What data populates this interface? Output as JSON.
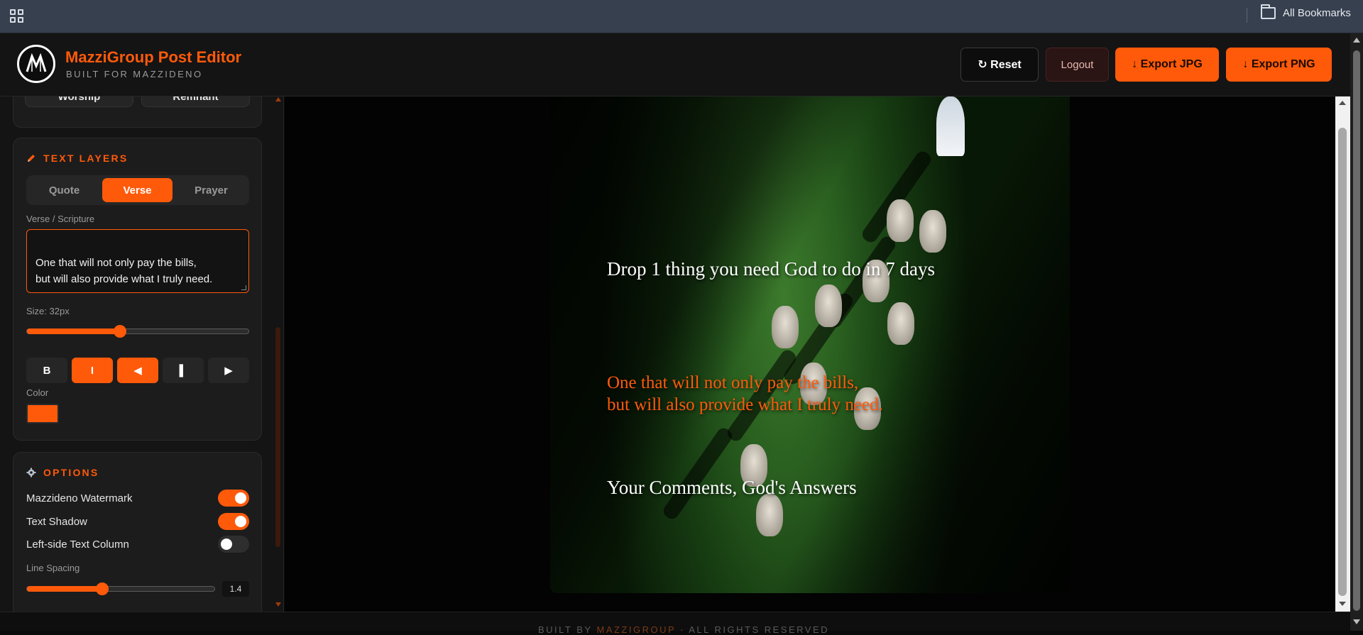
{
  "browser": {
    "bookmarks_label": "All Bookmarks",
    "apps_icon": "apps-grid-icon",
    "folder_icon": "folder-icon"
  },
  "header": {
    "title": "MazziGroup Post Editor",
    "subtitle": "BUILT FOR MAZZIDENO",
    "reset_label": "↻ Reset",
    "logout_label": "Logout",
    "export_jpg_label": "↓ Export JPG",
    "export_png_label": "↓ Export PNG"
  },
  "theme": {
    "accent": "#ff5a0a",
    "background": "#0a0a0a",
    "panel": "#1c1c1c"
  },
  "presets": {
    "items": [
      "Worship",
      "Remnant"
    ]
  },
  "text_layers": {
    "heading": "TEXT LAYERS",
    "tabs": [
      "Quote",
      "Verse",
      "Prayer"
    ],
    "active_tab": "Verse",
    "field_label": "Verse / Scripture",
    "field_value": "One that will not only pay the bills,\nbut will also provide what I truly need.",
    "size_label": "Size: 32px",
    "size_fraction": 0.42,
    "format_buttons": [
      "B",
      "I",
      "◀",
      "▌",
      "▶"
    ],
    "format_active": [
      false,
      true,
      true,
      false,
      false
    ],
    "color_label": "Color",
    "color_value": "#ff5a0a"
  },
  "options": {
    "heading": "OPTIONS",
    "toggles": [
      {
        "label": "Mazzideno Watermark",
        "on": true
      },
      {
        "label": "Text Shadow",
        "on": true
      },
      {
        "label": "Left-side Text Column",
        "on": false
      }
    ],
    "line_spacing_label": "Line Spacing",
    "line_spacing_value": "1.4",
    "line_spacing_fraction": 0.4
  },
  "canvas": {
    "quote_text": "Drop 1 thing you need God to do in 7 days",
    "verse_text": "One that will not only pay the bills,\nbut will also provide what I truly need.",
    "prayer_text": "Your Comments, God's Answers"
  },
  "footer": {
    "prefix": "BUILT BY ",
    "brand": "MAZZIGROUP",
    "suffix": " · ALL RIGHTS RESERVED"
  }
}
